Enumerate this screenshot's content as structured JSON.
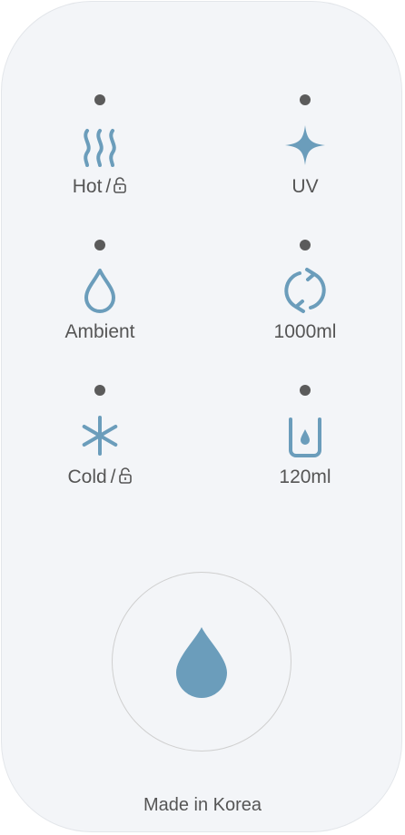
{
  "colors": {
    "panel_bg": "#f3f5f8",
    "icon": "#6b9dbb",
    "indicator_dot": "#5b5b5b",
    "text": "#555555",
    "button_border": "#cfcfcf"
  },
  "controls": [
    {
      "label": "Hot",
      "separator": "/",
      "has_lock": true,
      "icon": "heat-waves-icon"
    },
    {
      "label": "UV",
      "separator": "",
      "has_lock": false,
      "icon": "uv-sparkle-icon"
    },
    {
      "label": "Ambient",
      "separator": "",
      "has_lock": false,
      "icon": "water-drop-outline-icon"
    },
    {
      "label": "1000ml",
      "separator": "",
      "has_lock": false,
      "icon": "continuous-cycle-icon"
    },
    {
      "label": "Cold",
      "separator": "/",
      "has_lock": true,
      "icon": "snowflake-icon"
    },
    {
      "label": "120ml",
      "separator": "",
      "has_lock": false,
      "icon": "cup-icon"
    }
  ],
  "dispense_button": {
    "icon": "water-drop-filled-icon"
  },
  "footer": {
    "text": "Made in Korea"
  }
}
